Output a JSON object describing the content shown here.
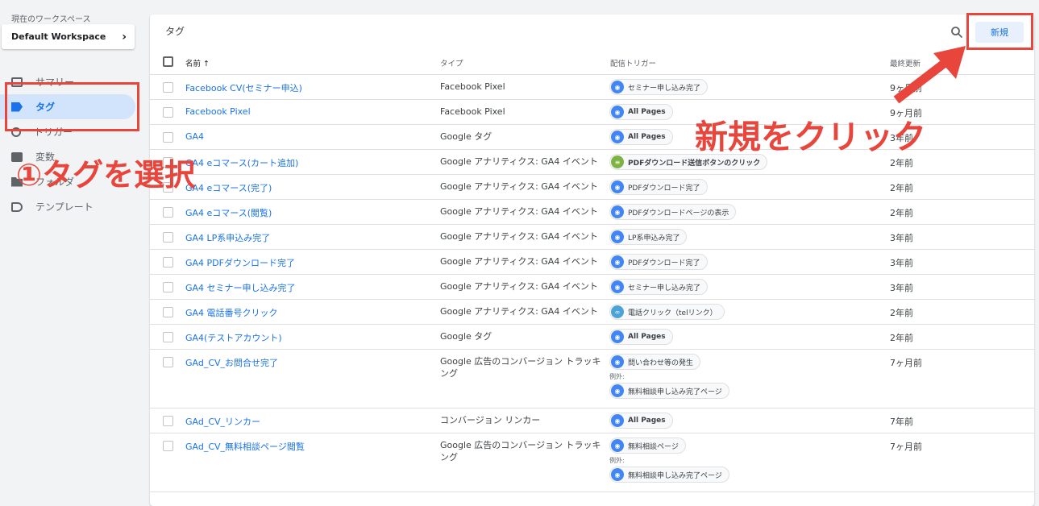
{
  "workspace": {
    "label": "現在のワークスペース",
    "name": "Default Workspace"
  },
  "nav": [
    {
      "label": "サマリー",
      "icon": "summary-icon",
      "active": false
    },
    {
      "label": "タグ",
      "icon": "tag-icon",
      "active": true
    },
    {
      "label": "トリガー",
      "icon": "trigger-icon",
      "active": false
    },
    {
      "label": "変数",
      "icon": "variable-icon",
      "active": false
    },
    {
      "label": "フォルダ",
      "icon": "folder-icon",
      "active": false
    },
    {
      "label": "テンプレート",
      "icon": "template-icon",
      "active": false
    }
  ],
  "main": {
    "title": "タグ",
    "new_button": "新規"
  },
  "table": {
    "columns": {
      "name": "名前 ↑",
      "type": "タイプ",
      "trigger": "配信トリガー",
      "updated": "最終更新"
    },
    "rows": [
      {
        "name": "Facebook CV(セミナー申込)",
        "type": "Facebook Pixel",
        "trigger": "セミナー申し込み完了",
        "trigger_icon": "eye",
        "updated": "9ヶ月前"
      },
      {
        "name": "Facebook Pixel",
        "type": "Facebook Pixel",
        "trigger": "All Pages",
        "trigger_icon": "eye",
        "updated": "9ヶ月前"
      },
      {
        "name": "GA4",
        "type": "Google タグ",
        "trigger": "All Pages",
        "trigger_icon": "eye",
        "updated": "3年前"
      },
      {
        "name": "GA4 eコマース(カート追加)",
        "type": "Google アナリティクス: GA4 イベント",
        "trigger": "PDFダウンロード送信ボタンのクリック",
        "trigger_icon": "click",
        "updated": "2年前"
      },
      {
        "name": "GA4 eコマース(完了)",
        "type": "Google アナリティクス: GA4 イベント",
        "trigger": "PDFダウンロード完了",
        "trigger_icon": "eye",
        "updated": "2年前"
      },
      {
        "name": "GA4 eコマース(閲覧)",
        "type": "Google アナリティクス: GA4 イベント",
        "trigger": "PDFダウンロードページの表示",
        "trigger_icon": "eye",
        "updated": "2年前"
      },
      {
        "name": "GA4 LP系申込み完了",
        "type": "Google アナリティクス: GA4 イベント",
        "trigger": "LP系申込み完了",
        "trigger_icon": "eye",
        "updated": "3年前"
      },
      {
        "name": "GA4 PDFダウンロード完了",
        "type": "Google アナリティクス: GA4 イベント",
        "trigger": "PDFダウンロード完了",
        "trigger_icon": "eye",
        "updated": "3年前"
      },
      {
        "name": "GA4 セミナー申し込み完了",
        "type": "Google アナリティクス: GA4 イベント",
        "trigger": "セミナー申し込み完了",
        "trigger_icon": "eye",
        "updated": "3年前"
      },
      {
        "name": "GA4 電話番号クリック",
        "type": "Google アナリティクス: GA4 イベント",
        "trigger": "電話クリック（telリンク）",
        "trigger_icon": "link",
        "updated": "2年前"
      },
      {
        "name": "GA4(テストアカウント)",
        "type": "Google タグ",
        "trigger": "All Pages",
        "trigger_icon": "eye",
        "updated": "2年前"
      },
      {
        "name": "GAd_CV_お問合せ完了",
        "type": "Google 広告のコンバージョン トラッキング",
        "trigger": "問い合わせ等の発生",
        "trigger_icon": "eye",
        "exception_label": "例外:",
        "exception": "無料相談申し込み完了ページ",
        "updated": "7ヶ月前"
      },
      {
        "name": "GAd_CV_リンカー",
        "type": "コンバージョン リンカー",
        "trigger": "All Pages",
        "trigger_icon": "eye",
        "updated": "7年前"
      },
      {
        "name": "GAd_CV_無料相談ページ閲覧",
        "type": "Google 広告のコンバージョン トラッキング",
        "trigger": "無料相談ページ",
        "trigger_icon": "eye",
        "exception_label": "例外:",
        "exception": "無料相談申し込み完了ページ",
        "updated": "7ヶ月前"
      }
    ]
  },
  "annotations": {
    "step1": "①タグを選択",
    "step2": "新規をクリック"
  },
  "colors": {
    "accent": "#1a73e8",
    "annotation": "#e8453c",
    "active_nav_bg": "#d2e3fc"
  }
}
